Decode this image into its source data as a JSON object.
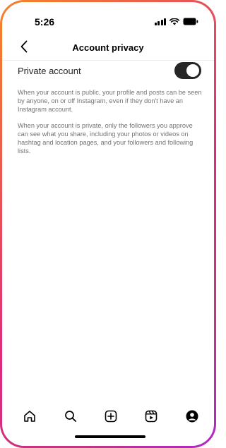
{
  "status_bar": {
    "time": "5:26",
    "icons": [
      "signal-icon",
      "wifi-icon",
      "battery-icon"
    ]
  },
  "header": {
    "back_icon": "chevron-left-icon",
    "title": "Account privacy"
  },
  "settings": {
    "private_account": {
      "label": "Private account",
      "enabled": true
    }
  },
  "descriptions": {
    "public": "When your account is public, your profile and posts can be seen by anyone, on or off Instagram, even if they don't have an Instagram account.",
    "private": "When your account is private, only the followers you approve can see what you share, including your photos or videos on hashtag and location pages, and your followers and following lists."
  },
  "bottom_nav": {
    "items": [
      "home-icon",
      "search-icon",
      "create-icon",
      "reels-icon",
      "profile-icon"
    ]
  },
  "colors": {
    "frame_gradient_start": "#f58529",
    "frame_gradient_end": "#b026c9",
    "toggle_on": "#262626",
    "description_text": "#737373"
  }
}
